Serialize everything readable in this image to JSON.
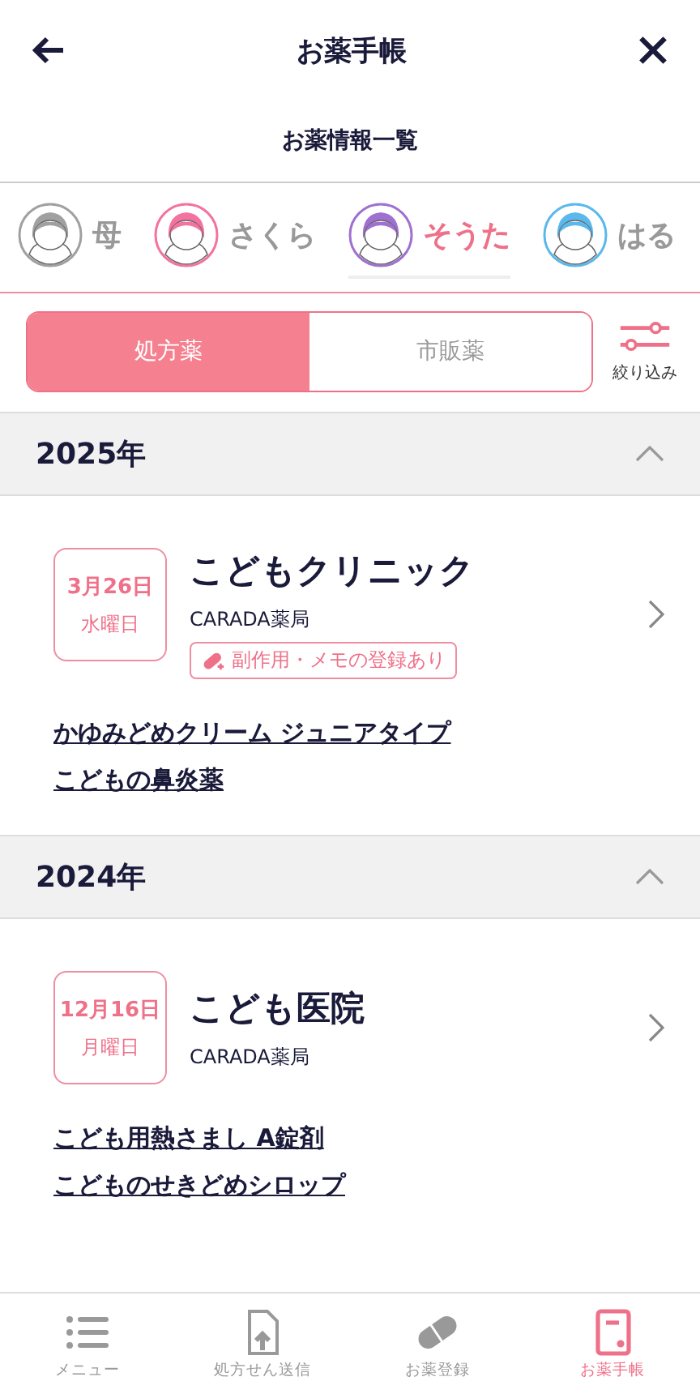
{
  "header": {
    "title": "お薬手帳",
    "subtitle": "お薬情報一覧"
  },
  "profiles": [
    {
      "name": "母",
      "color": "#a0a0a0",
      "selected": false
    },
    {
      "name": "さくら",
      "color": "#f472a0",
      "selected": false
    },
    {
      "name": "そうた",
      "color": "#a070d0",
      "selected": true
    },
    {
      "name": "はる",
      "color": "#5ab8ec",
      "selected": false
    }
  ],
  "segments": [
    {
      "label": "処方薬",
      "selected": true
    },
    {
      "label": "市販薬",
      "selected": false
    }
  ],
  "filter": {
    "label": "絞り込み"
  },
  "years": [
    {
      "year": "2025年",
      "expanded": true,
      "entries": [
        {
          "date": "3月26日",
          "weekday": "水曜日",
          "clinic": "こどもクリニック",
          "pharmacy": "CARADA薬局",
          "memo": "副作用・メモの登録あり",
          "drugs": [
            "かゆみどめクリーム ジュニアタイプ",
            "こどもの鼻炎薬"
          ]
        }
      ]
    },
    {
      "year": "2024年",
      "expanded": true,
      "entries": [
        {
          "date": "12月16日",
          "weekday": "月曜日",
          "clinic": "こども医院",
          "pharmacy": "CARADA薬局",
          "drugs": [
            "こども用熱さまし A錠剤",
            "こどものせきどめシロップ"
          ]
        }
      ]
    }
  ],
  "nav": [
    {
      "kind": "menu",
      "label": "メニュー",
      "selected": false
    },
    {
      "kind": "upload",
      "label": "処方せん送信",
      "selected": false
    },
    {
      "kind": "pill",
      "label": "お薬登録",
      "selected": false
    },
    {
      "kind": "book",
      "label": "お薬手帳",
      "selected": true
    }
  ]
}
